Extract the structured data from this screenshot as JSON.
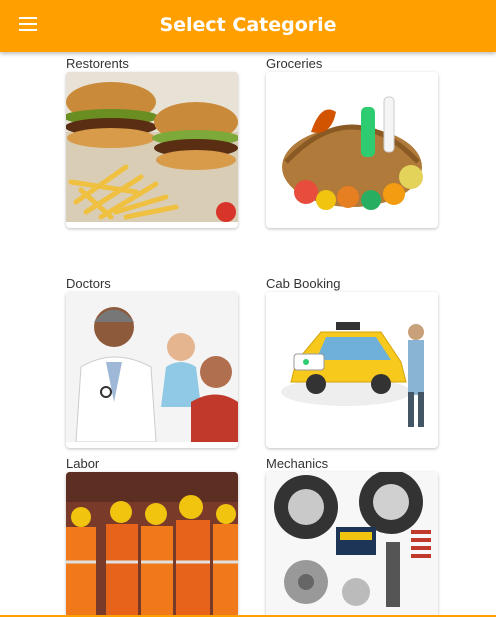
{
  "appbar": {
    "title": "Select Categorie",
    "menu_icon": "menu-icon",
    "color": "#ffa000"
  },
  "categories": [
    {
      "label": "Restorents",
      "image": "burger-fries-image"
    },
    {
      "label": "Groceries",
      "image": "grocery-basket-image"
    },
    {
      "label": "Doctors",
      "image": "doctor-with-baby-image"
    },
    {
      "label": "Cab Booking",
      "image": "taxi-app-image"
    },
    {
      "label": "Labor",
      "image": "workers-image"
    },
    {
      "label": "Mechanics",
      "image": "auto-parts-image"
    }
  ]
}
